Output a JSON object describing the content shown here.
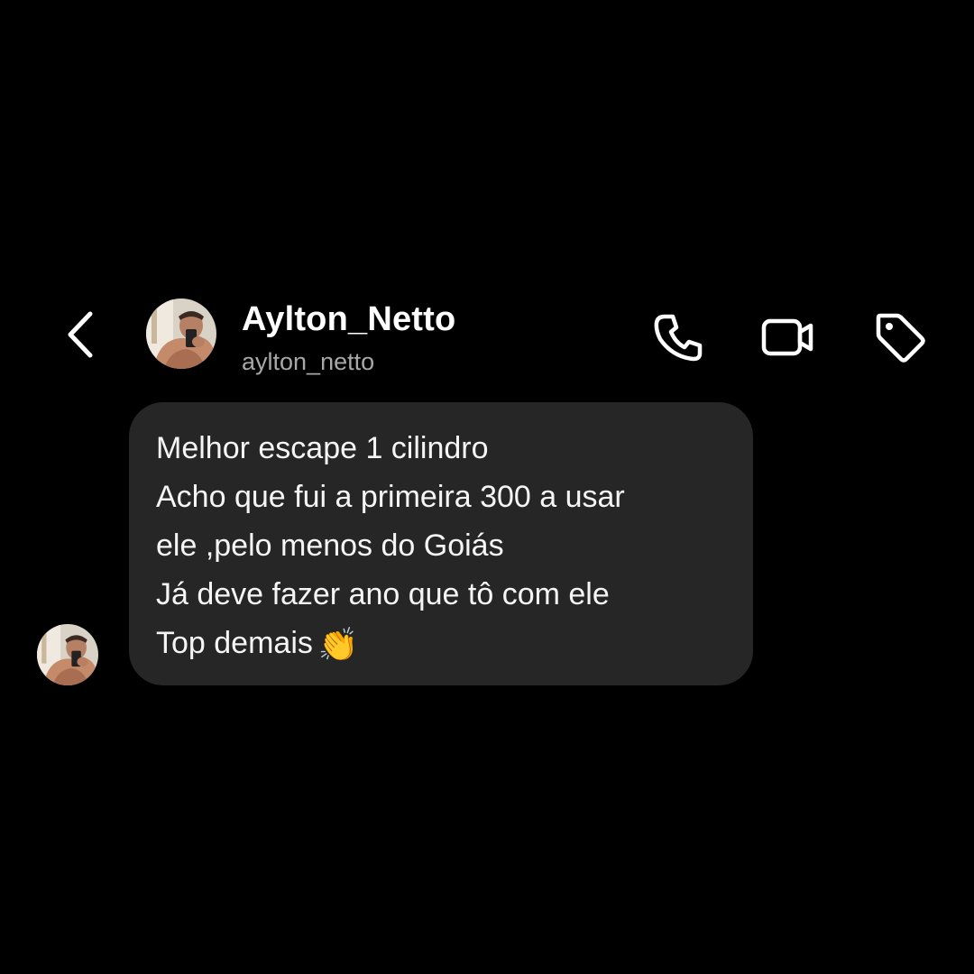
{
  "header": {
    "back_icon": "chevron-left-icon",
    "display_name": "Aylton_Netto",
    "username": "aylton_netto",
    "actions": [
      {
        "name": "call",
        "icon": "phone-icon"
      },
      {
        "name": "video",
        "icon": "video-camera-icon"
      },
      {
        "name": "tag",
        "icon": "tag-icon"
      }
    ]
  },
  "message": {
    "lines": [
      "Melhor escape 1 cilindro",
      "Acho que fui a primeira 300 a usar",
      "ele ,pelo menos do Goiás",
      "Já deve fazer ano que tô com ele",
      "Top demais"
    ],
    "emoji": "👏"
  },
  "colors": {
    "background": "#000000",
    "bubble": "#262626",
    "text": "#ffffff",
    "secondary_text": "#a8a8a8"
  }
}
